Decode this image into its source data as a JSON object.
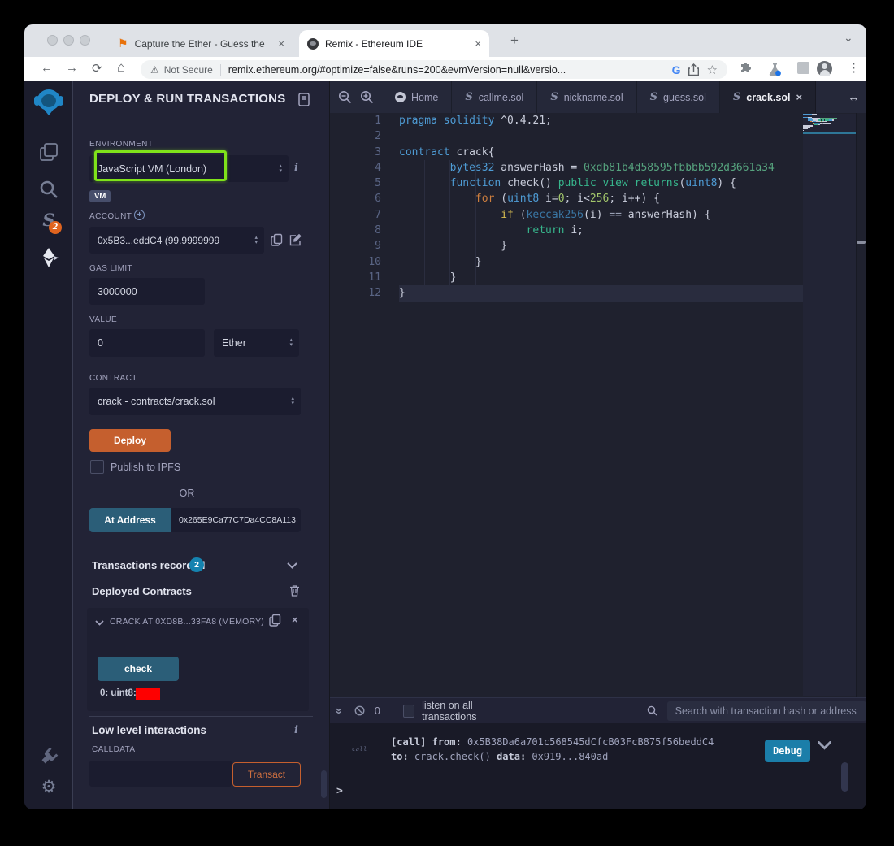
{
  "colors": {
    "deploy_orange": "#c55f2e",
    "action_teal": "#2b5e78",
    "debug_blue": "#1b7ea9",
    "count_badge_blue": "#1583b0",
    "compiler_badge_orange": "#e0641f",
    "highlight_green": "#7fe21a",
    "redacted_red": "#fe0000",
    "panel_bg": "#222336"
  },
  "browser": {
    "tabs": [
      {
        "label": "Capture the Ether - Guess the",
        "close": "×"
      },
      {
        "label": "Remix - Ethereum IDE",
        "close": "×",
        "active": true
      }
    ],
    "new_tab_button": "+",
    "tab_search_chevron": "⌄",
    "nav": {
      "back": "←",
      "forward": "→",
      "reload": "⟳",
      "home": "⌂"
    },
    "url_bar": {
      "warning_icon": "⚠",
      "warning_text": "Not Secure",
      "address": "remix.ethereum.org/#optimize=false&runs=200&evmVersion=null&versio...",
      "google_letter": "G",
      "bookmark_star": "☆"
    },
    "menu_dots": "⋮"
  },
  "sidebar": {
    "compiler_badge": "2"
  },
  "deploy_panel": {
    "title": "DEPLOY & RUN TRANSACTIONS",
    "environment_label": "ENVIRONMENT",
    "environment_value": "JavaScript VM (London)",
    "vm_badge": "VM",
    "account_label": "ACCOUNT",
    "account_value": "0x5B3...eddC4 (99.9999999",
    "gas_label": "GAS LIMIT",
    "gas_value": "3000000",
    "value_label": "VALUE",
    "value_value": "0",
    "value_unit": "Ether",
    "contract_label": "CONTRACT",
    "contract_value": "crack - contracts/crack.sol",
    "deploy_button": "Deploy",
    "publish_label": "Publish to IPFS",
    "or_text": "OR",
    "at_address_button": "At Address",
    "at_address_value": "0x265E9Ca77C7Da4CC8A113",
    "transactions_recorded": "Transactions recorded",
    "transactions_count": "2",
    "deployed_contracts": "Deployed Contracts",
    "card": {
      "title": "CRACK AT 0XD8B...33FA8 (MEMORY)",
      "check_button": "check",
      "output_label": "0: uint8:",
      "low_level": "Low level interactions",
      "calldata_label": "CALLDATA",
      "transact_button": "Transact"
    }
  },
  "editor": {
    "tabs": [
      {
        "label": "Home",
        "icon": "remix"
      },
      {
        "label": "callme.sol",
        "icon": "solidity"
      },
      {
        "label": "nickname.sol",
        "icon": "solidity"
      },
      {
        "label": "guess.sol",
        "icon": "solidity"
      },
      {
        "label": "crack.sol",
        "icon": "solidity",
        "active": true
      }
    ],
    "current_line": 12,
    "code": [
      [
        [
          "pragma solidity",
          "kw"
        ],
        [
          " ^0.4.21;",
          "pl"
        ]
      ],
      [],
      [
        [
          "contract",
          "kw"
        ],
        [
          " crack{",
          "pl"
        ]
      ],
      [
        [
          "        ",
          "pl"
        ],
        [
          "bytes32",
          "kw"
        ],
        [
          " answerHash = ",
          "pl"
        ],
        [
          "0xdb81b4d58595fbbbb592d3661a34",
          "hex"
        ]
      ],
      [
        [
          "        ",
          "pl"
        ],
        [
          "function",
          "kw"
        ],
        [
          " check() ",
          "pl"
        ],
        [
          "public",
          "fn"
        ],
        [
          " ",
          "pl"
        ],
        [
          "view",
          "fn"
        ],
        [
          " ",
          "pl"
        ],
        [
          "returns",
          "fn"
        ],
        [
          "(",
          "pl"
        ],
        [
          "uint8",
          "kw"
        ],
        [
          ") {",
          "pl"
        ]
      ],
      [
        [
          "            ",
          "pl"
        ],
        [
          "for",
          "ctrl"
        ],
        [
          " (",
          "pl"
        ],
        [
          "uint8",
          "kw"
        ],
        [
          " i=",
          "pl"
        ],
        [
          "0",
          "num"
        ],
        [
          "; i<",
          "pl"
        ],
        [
          "256",
          "num"
        ],
        [
          "; i++) {",
          "pl"
        ]
      ],
      [
        [
          "                ",
          "pl"
        ],
        [
          "if",
          "cond"
        ],
        [
          " (",
          "pl"
        ],
        [
          "keccak256",
          "call"
        ],
        [
          "(i) ",
          "pl"
        ],
        [
          "==",
          "op"
        ],
        [
          " answerHash) {",
          "pl"
        ]
      ],
      [
        [
          "                    ",
          "pl"
        ],
        [
          "return",
          "fn"
        ],
        [
          " i;",
          "pl"
        ]
      ],
      [
        [
          "                }",
          "pl"
        ]
      ],
      [
        [
          "            }",
          "pl"
        ]
      ],
      [
        [
          "        }",
          "pl"
        ]
      ],
      [
        [
          "}",
          "pl"
        ]
      ]
    ]
  },
  "terminal": {
    "pending_count": "0",
    "listen_label": "listen on all transactions",
    "search_placeholder": "Search with transaction hash or address",
    "log_tag": "call",
    "log_lines": [
      [
        [
          "[call]",
          "b"
        ],
        [
          " ",
          "r"
        ],
        [
          "from:",
          "b"
        ],
        [
          " 0x5B38Da6a701c568545dCfcB03FcB875f56beddC4",
          "r"
        ]
      ],
      [
        [
          "to:",
          "b"
        ],
        [
          " crack.check() ",
          "r"
        ],
        [
          "data:",
          "b"
        ],
        [
          " 0x919...840ad",
          "r"
        ]
      ]
    ],
    "debug_button": "Debug",
    "prompt": ">"
  }
}
